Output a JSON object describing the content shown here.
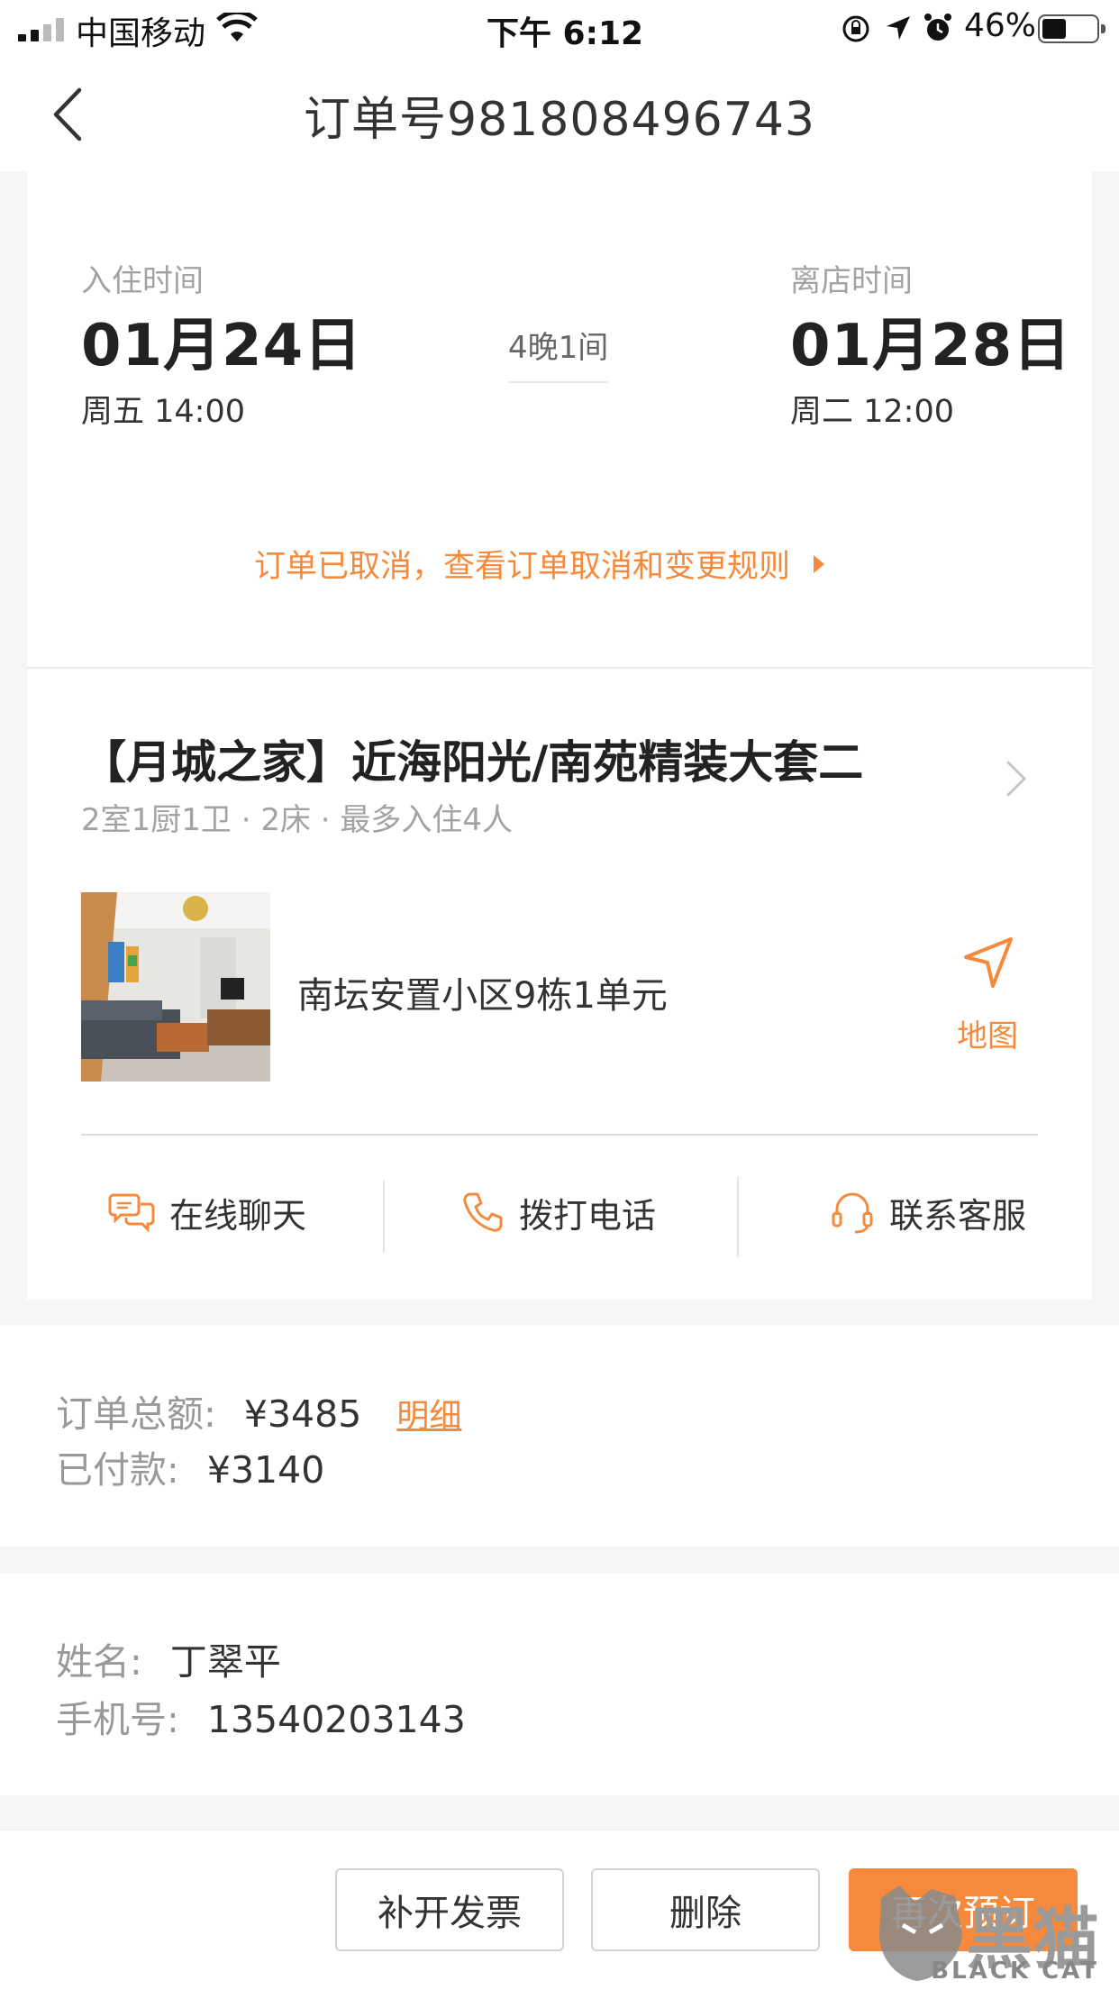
{
  "status_bar": {
    "carrier": "中国移动",
    "time": "下午 6:12",
    "battery_percent": "46%",
    "battery_level": 0.46
  },
  "nav": {
    "title": "订单号981808496743"
  },
  "stay": {
    "checkin_label": "入住时间",
    "checkin_date": "01月24日",
    "checkin_daytime": "周五 14:00",
    "nights": "4晚1间",
    "checkout_label": "离店时间",
    "checkout_date": "01月28日",
    "checkout_daytime": "周二 12:00",
    "cancel_notice": "订单已取消，查看订单取消和变更规则"
  },
  "house": {
    "title": "【月城之家】近海阳光/南苑精装大套二",
    "meta": "2室1厨1卫 · 2床 · 最多入住4人",
    "address": "南坛安置小区9栋1单元",
    "map_label": "地图"
  },
  "actions": {
    "chat": "在线聊天",
    "call": "拨打电话",
    "service": "联系客服"
  },
  "payment": {
    "total_key": "订单总额:",
    "total_value": "¥3485",
    "detail_link": "明细",
    "paid_key": "已付款:",
    "paid_value": "¥3140"
  },
  "guest": {
    "name_key": "姓名:",
    "name_value": "丁翠平",
    "phone_key": "手机号:",
    "phone_value": "13540203143"
  },
  "bottom": {
    "invoice": "补开发票",
    "delete": "删除",
    "rebook": "再次预订"
  },
  "watermark": {
    "cn": "黑猫",
    "en": "BLACK CAT"
  },
  "colors": {
    "accent": "#f58a3c",
    "background": "#f5f5f7"
  }
}
